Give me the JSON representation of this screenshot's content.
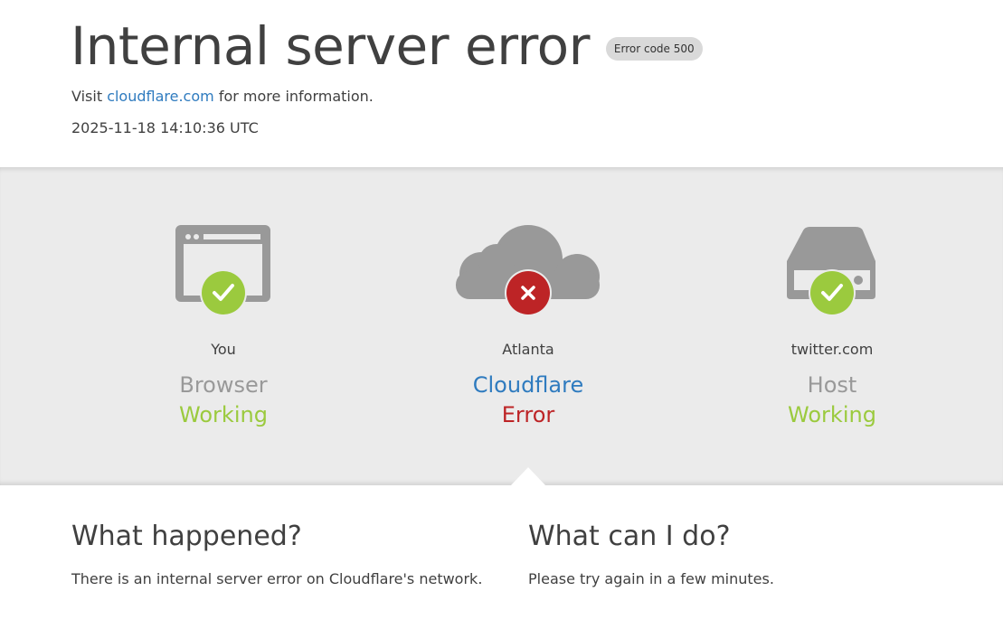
{
  "header": {
    "title": "Internal server error",
    "error_badge": "Error code 500",
    "visit_prefix": "Visit",
    "visit_link": "cloudflare.com",
    "visit_suffix": "for more information.",
    "timestamp": "2025-11-18 14:10:36 UTC"
  },
  "status": {
    "browser": {
      "location": "You",
      "role": "Browser",
      "state": "Working",
      "icon": "browser-window-icon",
      "badge_icon": "check-icon"
    },
    "cloudflare": {
      "location": "Atlanta",
      "role": "Cloudflare",
      "state": "Error",
      "icon": "cloud-icon",
      "badge_icon": "x-icon"
    },
    "host": {
      "location": "twitter.com",
      "role": "Host",
      "state": "Working",
      "icon": "server-drive-icon",
      "badge_icon": "check-icon"
    }
  },
  "info": {
    "what_happened_title": "What happened?",
    "what_happened_text": "There is an internal server error on Cloudflare's network.",
    "what_can_i_do_title": "What can I do?",
    "what_can_i_do_text": "Please try again in a few minutes."
  },
  "colors": {
    "working": "#9bca3e",
    "error": "#bd2426",
    "link": "#2f7bbf",
    "icon_gray": "#999999",
    "band": "#ebebeb"
  }
}
